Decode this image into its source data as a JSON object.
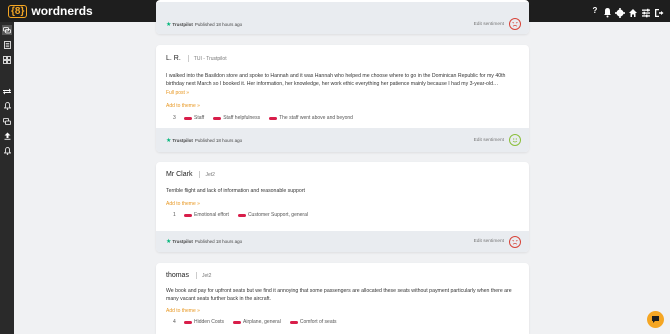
{
  "app": {
    "logo_mark": "{8}",
    "name": "wordnerds"
  },
  "topbar": {
    "icons": [
      "help-icon",
      "bell-icon",
      "gear-icon",
      "home-icon",
      "filter-icon",
      "logout-icon"
    ],
    "help_glyph": "?"
  },
  "sidebar": {
    "icons": [
      "chat-icon",
      "document-icon",
      "grid-icon",
      "swap-icon",
      "bell-icon",
      "conversation-icon",
      "upload-icon",
      "notification-icon"
    ]
  },
  "colors": {
    "accent": "#f5a623",
    "tag": "#d81e4a",
    "trustpilot": "#00b67a"
  },
  "reviews": [
    {
      "author": "",
      "source": "",
      "text": "",
      "footer": {
        "source": "Trustpilot",
        "published": "Published 18 hours ago",
        "edit": "Edit sentiment",
        "sentiment": "negative"
      }
    },
    {
      "author": "L. R.",
      "source": "TUI - Trustpilot",
      "text": "I walked into the Basildon store and spoke to Hannah and it was Hannah who helped me choose where to go in the Dominican Republic for my 40th birthday next March so I booked it. Her information, her knowledge, her work ethic everything her patience mainly because I had my 3-year-old…",
      "more": "Full post »",
      "add_theme": "Add to theme »",
      "count": "3",
      "tags": [
        "Staff",
        "Staff helpfulness",
        "The staff went above and beyond"
      ],
      "footer": {
        "source": "Trustpilot",
        "published": "Published 18 hours ago",
        "edit": "Edit sentiment",
        "sentiment": "positive"
      }
    },
    {
      "author": "Mr Clark",
      "source": "Jet2",
      "text": "Terrible flight and lack of information and reasonable support",
      "add_theme": "Add to theme »",
      "count": "1",
      "tags": [
        "Emotional effort",
        "Customer Support, general"
      ],
      "footer": {
        "source": "Trustpilot",
        "published": "Published 18 hours ago",
        "edit": "Edit sentiment",
        "sentiment": "negative"
      }
    },
    {
      "author": "thomas",
      "source": "Jet2",
      "text": "We book and pay for upfront seats but we find it annoying that some passengers are allocated these seats without payment particularly when there are many vacant seats further back in the aircraft.",
      "add_theme": "Add to theme »",
      "count": "4",
      "tags": [
        "Hidden Costs",
        "Airplane, general",
        "Comfort of seats"
      ]
    }
  ]
}
